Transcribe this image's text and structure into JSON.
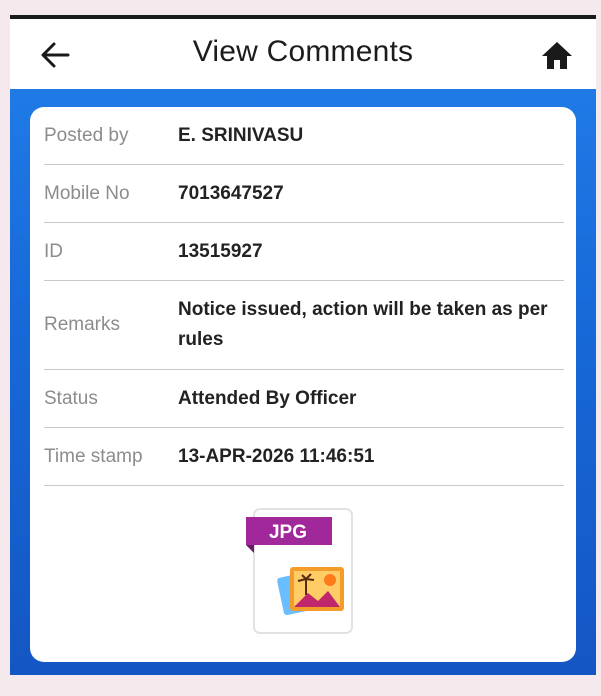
{
  "header": {
    "title": "View Comments",
    "back_icon": "arrow-left-icon",
    "home_icon": "home-icon"
  },
  "details": [
    {
      "label": "Posted by",
      "value": "E. SRINIVASU"
    },
    {
      "label": "Mobile No",
      "value": "7013647527"
    },
    {
      "label": "ID",
      "value": "13515927"
    },
    {
      "label": "Remarks",
      "value": "Notice issued, action will be taken as per rules"
    },
    {
      "label": "Status",
      "value": "Attended By Officer"
    },
    {
      "label": "Time stamp",
      "value": "13-APR-2026 11:46:51"
    }
  ],
  "attachment": {
    "type_label": "JPG",
    "icon": "jpg-file-icon"
  },
  "colors": {
    "background_blue": "#1769d8",
    "jpg_badge": "#a0289b"
  }
}
